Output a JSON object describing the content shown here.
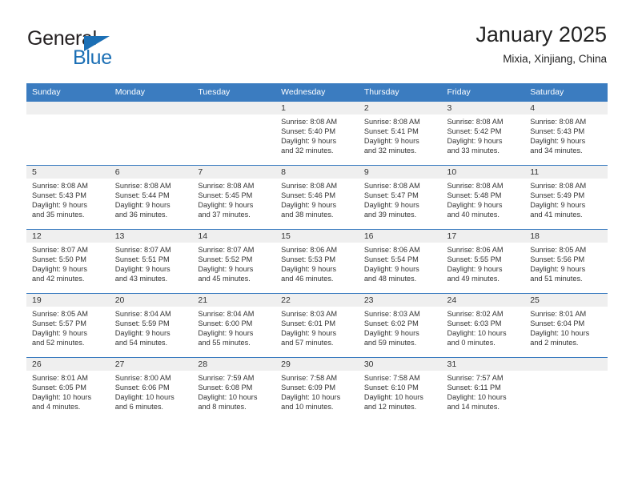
{
  "brand": {
    "word1": "General",
    "word2": "Blue",
    "flag_icon": "triangle-flag-icon",
    "accent_color": "#1b6fb5"
  },
  "header": {
    "title": "January 2025",
    "subtitle": "Mixia, Xinjiang, China"
  },
  "calendar": {
    "header_color": "#3b7cc0",
    "daynum_band_color": "#efefef",
    "weekday_headers": [
      "Sunday",
      "Monday",
      "Tuesday",
      "Wednesday",
      "Thursday",
      "Friday",
      "Saturday"
    ],
    "weeks": [
      [
        {
          "day": "",
          "empty": true,
          "lines": []
        },
        {
          "day": "",
          "empty": true,
          "lines": []
        },
        {
          "day": "",
          "empty": true,
          "lines": []
        },
        {
          "day": "1",
          "empty": false,
          "lines": [
            "Sunrise: 8:08 AM",
            "Sunset: 5:40 PM",
            "Daylight: 9 hours",
            "and 32 minutes."
          ]
        },
        {
          "day": "2",
          "empty": false,
          "lines": [
            "Sunrise: 8:08 AM",
            "Sunset: 5:41 PM",
            "Daylight: 9 hours",
            "and 32 minutes."
          ]
        },
        {
          "day": "3",
          "empty": false,
          "lines": [
            "Sunrise: 8:08 AM",
            "Sunset: 5:42 PM",
            "Daylight: 9 hours",
            "and 33 minutes."
          ]
        },
        {
          "day": "4",
          "empty": false,
          "lines": [
            "Sunrise: 8:08 AM",
            "Sunset: 5:43 PM",
            "Daylight: 9 hours",
            "and 34 minutes."
          ]
        }
      ],
      [
        {
          "day": "5",
          "empty": false,
          "lines": [
            "Sunrise: 8:08 AM",
            "Sunset: 5:43 PM",
            "Daylight: 9 hours",
            "and 35 minutes."
          ]
        },
        {
          "day": "6",
          "empty": false,
          "lines": [
            "Sunrise: 8:08 AM",
            "Sunset: 5:44 PM",
            "Daylight: 9 hours",
            "and 36 minutes."
          ]
        },
        {
          "day": "7",
          "empty": false,
          "lines": [
            "Sunrise: 8:08 AM",
            "Sunset: 5:45 PM",
            "Daylight: 9 hours",
            "and 37 minutes."
          ]
        },
        {
          "day": "8",
          "empty": false,
          "lines": [
            "Sunrise: 8:08 AM",
            "Sunset: 5:46 PM",
            "Daylight: 9 hours",
            "and 38 minutes."
          ]
        },
        {
          "day": "9",
          "empty": false,
          "lines": [
            "Sunrise: 8:08 AM",
            "Sunset: 5:47 PM",
            "Daylight: 9 hours",
            "and 39 minutes."
          ]
        },
        {
          "day": "10",
          "empty": false,
          "lines": [
            "Sunrise: 8:08 AM",
            "Sunset: 5:48 PM",
            "Daylight: 9 hours",
            "and 40 minutes."
          ]
        },
        {
          "day": "11",
          "empty": false,
          "lines": [
            "Sunrise: 8:08 AM",
            "Sunset: 5:49 PM",
            "Daylight: 9 hours",
            "and 41 minutes."
          ]
        }
      ],
      [
        {
          "day": "12",
          "empty": false,
          "lines": [
            "Sunrise: 8:07 AM",
            "Sunset: 5:50 PM",
            "Daylight: 9 hours",
            "and 42 minutes."
          ]
        },
        {
          "day": "13",
          "empty": false,
          "lines": [
            "Sunrise: 8:07 AM",
            "Sunset: 5:51 PM",
            "Daylight: 9 hours",
            "and 43 minutes."
          ]
        },
        {
          "day": "14",
          "empty": false,
          "lines": [
            "Sunrise: 8:07 AM",
            "Sunset: 5:52 PM",
            "Daylight: 9 hours",
            "and 45 minutes."
          ]
        },
        {
          "day": "15",
          "empty": false,
          "lines": [
            "Sunrise: 8:06 AM",
            "Sunset: 5:53 PM",
            "Daylight: 9 hours",
            "and 46 minutes."
          ]
        },
        {
          "day": "16",
          "empty": false,
          "lines": [
            "Sunrise: 8:06 AM",
            "Sunset: 5:54 PM",
            "Daylight: 9 hours",
            "and 48 minutes."
          ]
        },
        {
          "day": "17",
          "empty": false,
          "lines": [
            "Sunrise: 8:06 AM",
            "Sunset: 5:55 PM",
            "Daylight: 9 hours",
            "and 49 minutes."
          ]
        },
        {
          "day": "18",
          "empty": false,
          "lines": [
            "Sunrise: 8:05 AM",
            "Sunset: 5:56 PM",
            "Daylight: 9 hours",
            "and 51 minutes."
          ]
        }
      ],
      [
        {
          "day": "19",
          "empty": false,
          "lines": [
            "Sunrise: 8:05 AM",
            "Sunset: 5:57 PM",
            "Daylight: 9 hours",
            "and 52 minutes."
          ]
        },
        {
          "day": "20",
          "empty": false,
          "lines": [
            "Sunrise: 8:04 AM",
            "Sunset: 5:59 PM",
            "Daylight: 9 hours",
            "and 54 minutes."
          ]
        },
        {
          "day": "21",
          "empty": false,
          "lines": [
            "Sunrise: 8:04 AM",
            "Sunset: 6:00 PM",
            "Daylight: 9 hours",
            "and 55 minutes."
          ]
        },
        {
          "day": "22",
          "empty": false,
          "lines": [
            "Sunrise: 8:03 AM",
            "Sunset: 6:01 PM",
            "Daylight: 9 hours",
            "and 57 minutes."
          ]
        },
        {
          "day": "23",
          "empty": false,
          "lines": [
            "Sunrise: 8:03 AM",
            "Sunset: 6:02 PM",
            "Daylight: 9 hours",
            "and 59 minutes."
          ]
        },
        {
          "day": "24",
          "empty": false,
          "lines": [
            "Sunrise: 8:02 AM",
            "Sunset: 6:03 PM",
            "Daylight: 10 hours",
            "and 0 minutes."
          ]
        },
        {
          "day": "25",
          "empty": false,
          "lines": [
            "Sunrise: 8:01 AM",
            "Sunset: 6:04 PM",
            "Daylight: 10 hours",
            "and 2 minutes."
          ]
        }
      ],
      [
        {
          "day": "26",
          "empty": false,
          "lines": [
            "Sunrise: 8:01 AM",
            "Sunset: 6:05 PM",
            "Daylight: 10 hours",
            "and 4 minutes."
          ]
        },
        {
          "day": "27",
          "empty": false,
          "lines": [
            "Sunrise: 8:00 AM",
            "Sunset: 6:06 PM",
            "Daylight: 10 hours",
            "and 6 minutes."
          ]
        },
        {
          "day": "28",
          "empty": false,
          "lines": [
            "Sunrise: 7:59 AM",
            "Sunset: 6:08 PM",
            "Daylight: 10 hours",
            "and 8 minutes."
          ]
        },
        {
          "day": "29",
          "empty": false,
          "lines": [
            "Sunrise: 7:58 AM",
            "Sunset: 6:09 PM",
            "Daylight: 10 hours",
            "and 10 minutes."
          ]
        },
        {
          "day": "30",
          "empty": false,
          "lines": [
            "Sunrise: 7:58 AM",
            "Sunset: 6:10 PM",
            "Daylight: 10 hours",
            "and 12 minutes."
          ]
        },
        {
          "day": "31",
          "empty": false,
          "lines": [
            "Sunrise: 7:57 AM",
            "Sunset: 6:11 PM",
            "Daylight: 10 hours",
            "and 14 minutes."
          ]
        },
        {
          "day": "",
          "empty": true,
          "lines": []
        }
      ]
    ]
  }
}
